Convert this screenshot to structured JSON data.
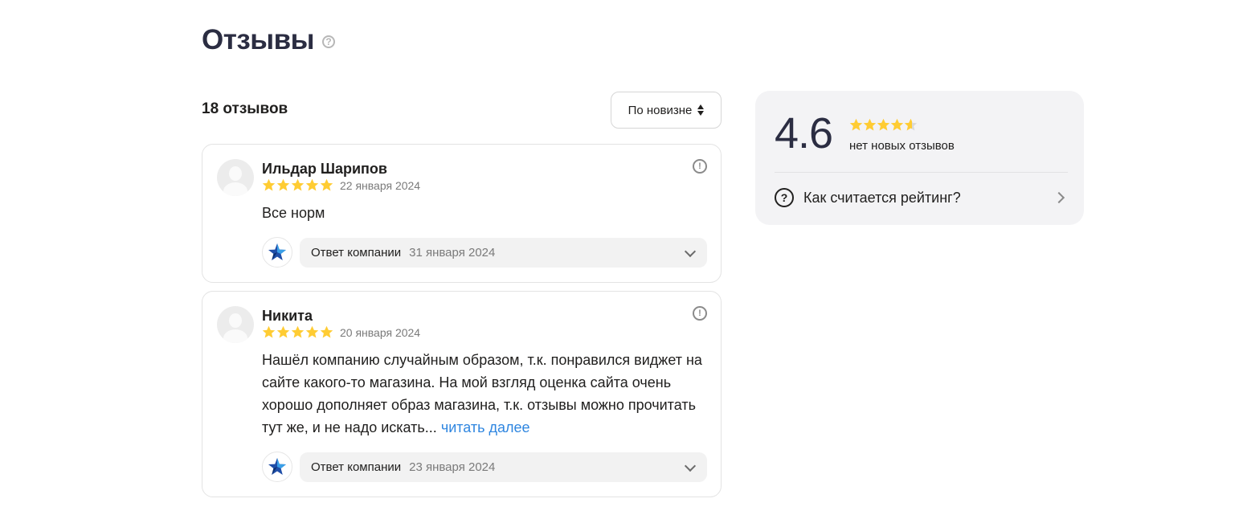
{
  "header": {
    "title": "Отзывы",
    "help_icon": "?"
  },
  "reviews_summary": {
    "count_label": "18 отзывов",
    "sort_label": "По новизне"
  },
  "reviews": [
    {
      "author": "Ильдар Шарипов",
      "rating": 5,
      "date": "22 января 2024",
      "text": "Все норм",
      "read_more": "",
      "reply_label": "Ответ компании",
      "reply_date": "31 января 2024"
    },
    {
      "author": "Никита",
      "rating": 5,
      "date": "20 января 2024",
      "text": "Нашёл компанию случайным образом, т.к. понравился виджет на сайте какого-то магазина. На мой взгляд оценка сайта очень хорошо дополняет образ магазина, т.к. отзывы можно прочитать тут же, и не надо искать...",
      "read_more": "читать далее",
      "reply_label": "Ответ компании",
      "reply_date": "23 января 2024"
    }
  ],
  "rating_panel": {
    "value": "4.6",
    "stars": 4.6,
    "subtitle": "нет новых отзывов",
    "info_label": "Как считается рейтинг?"
  },
  "colors": {
    "star": "#ffcc33",
    "star_empty": "#d9d9d9",
    "link": "#2f86e0",
    "title": "#2b2d42",
    "panel_bg": "#f3f3f5"
  },
  "icons": {
    "report": "exclamation-circle-icon",
    "company_logo": "blue-star-icon",
    "expand": "chevron-down-icon",
    "info": "question-circle-icon",
    "open": "chevron-right-icon"
  }
}
